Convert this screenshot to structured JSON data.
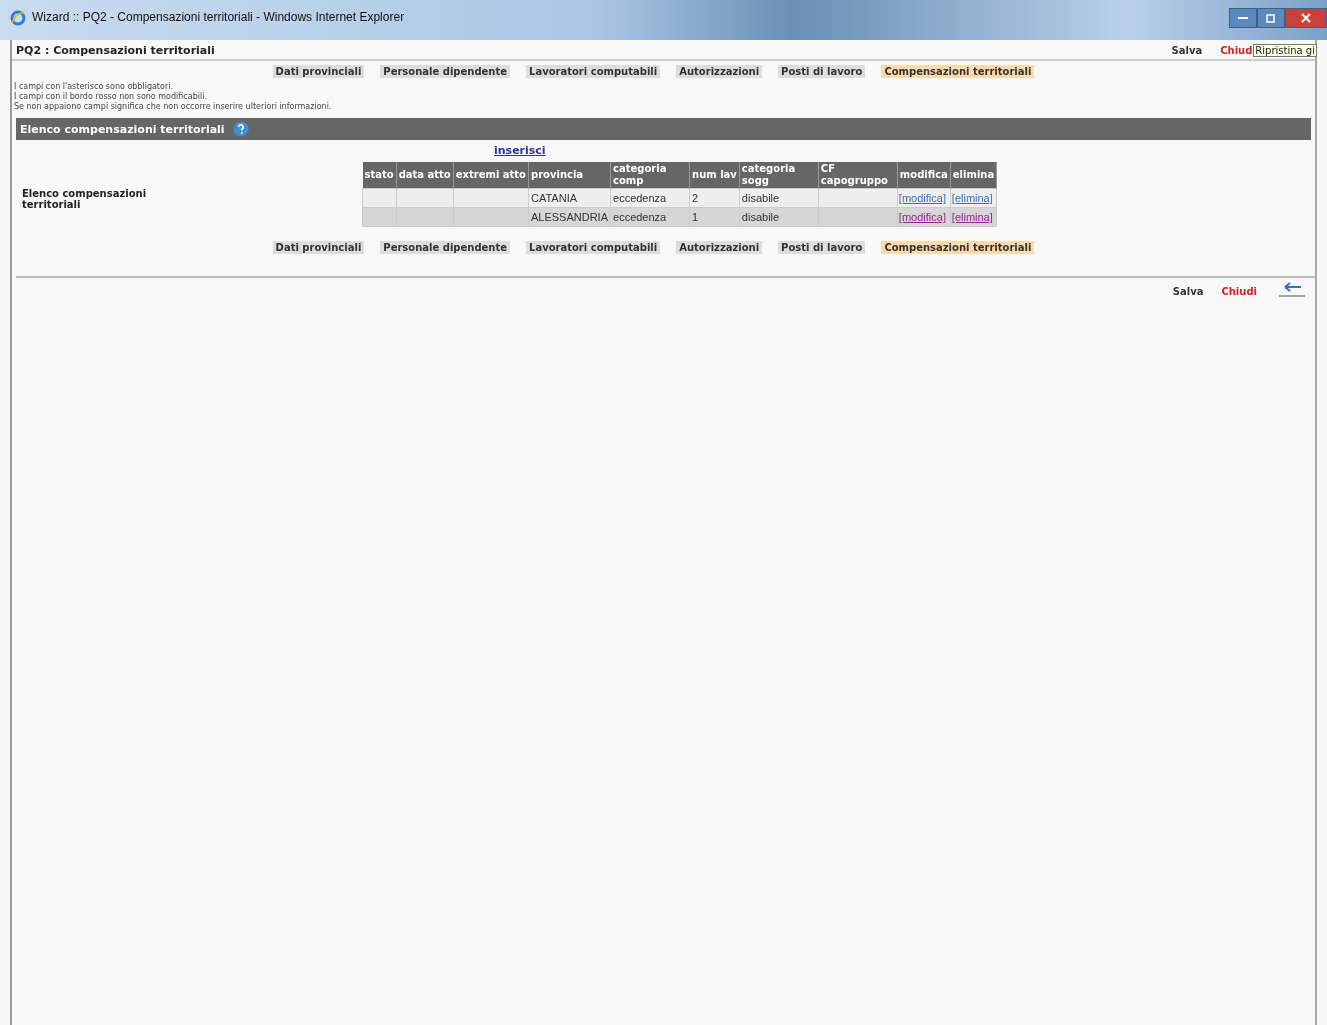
{
  "window": {
    "title": "Wizard :: PQ2 - Compensazioni territoriali - Windows Internet Explorer",
    "tooltip": "Ripristina gi"
  },
  "header": {
    "title": "PQ2 : Compensazioni territoriali",
    "actions": [
      {
        "label": "Salva",
        "kind": "save"
      },
      {
        "label": "Chiud",
        "kind": "close"
      }
    ]
  },
  "tabs": [
    {
      "label": "Dati provinciali",
      "selected": false
    },
    {
      "label": "Personale dipendente",
      "selected": false
    },
    {
      "label": "Lavoratori computabili",
      "selected": false
    },
    {
      "label": "Autorizzazioni",
      "selected": false
    },
    {
      "label": "Posti di lavoro",
      "selected": false
    },
    {
      "label": "Compensazioni territoriali",
      "selected": true
    }
  ],
  "notes": [
    "I campi con l'asterisco sono obbligatori.",
    "I campi con il bordo rosso non sono modificabili.",
    "Se non appaiono campi significa che non occorre inserire ulteriori informazioni."
  ],
  "section": {
    "title": "Elenco compensazioni territoriali",
    "label": "Elenco compensazioni territoriali",
    "insert_link": "inserisci"
  },
  "table": {
    "columns": [
      "stato",
      "data atto",
      "extremi atto",
      "provincia",
      "categoria comp",
      "num lav",
      "categoria sogg",
      "CF capogruppo",
      "modifica",
      "elimina"
    ],
    "rows": [
      {
        "cells": [
          "",
          "",
          "",
          "CATANIA",
          "eccedenza",
          "2",
          "disabile",
          ""
        ],
        "edit": "[modifica]",
        "delete": "[elimina]",
        "visited": false
      },
      {
        "cells": [
          "",
          "",
          "",
          "ALESSANDRIA",
          "eccedenza",
          "1",
          "disabile",
          ""
        ],
        "edit": "[modifica]",
        "delete": "[elimina]",
        "visited": true
      }
    ]
  },
  "bottom_tabs": [
    {
      "label": "Dati provinciali",
      "selected": false
    },
    {
      "label": "Personale dipendente",
      "selected": false
    },
    {
      "label": "Lavoratori computabili",
      "selected": false
    },
    {
      "label": "Autorizzazioni",
      "selected": false
    },
    {
      "label": "Posti di lavoro",
      "selected": false
    },
    {
      "label": "Compensazioni territoriali",
      "selected": true
    }
  ],
  "footer": {
    "actions": [
      {
        "label": "Salva",
        "kind": "save"
      },
      {
        "label": "Chiudi",
        "kind": "close"
      }
    ]
  }
}
